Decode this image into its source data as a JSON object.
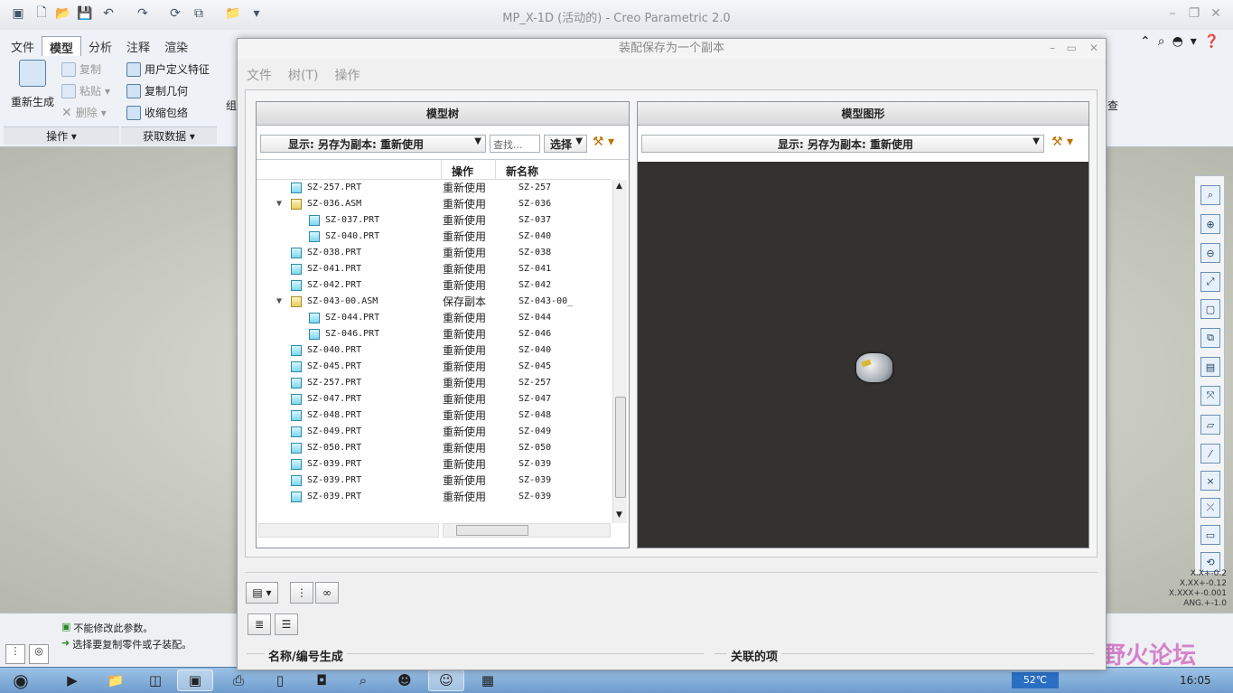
{
  "app": {
    "title": "MP_X-1D (活动的) - Creo Parametric 2.0"
  },
  "ribbon": {
    "tabs": [
      {
        "label": "文件"
      },
      {
        "label": "模型"
      },
      {
        "label": "分析"
      },
      {
        "label": "注释"
      },
      {
        "label": "渲染"
      }
    ],
    "regen_label": "重新生成",
    "copy_label": "复制",
    "paste_label": "粘贴",
    "delete_label": "删除",
    "udf_label": "用户定义特征",
    "copy_geom_label": "复制几何",
    "shrinkwrap_label": "收缩包络",
    "group_ops": "操作 ▾",
    "group_data": "获取数据 ▾",
    "partial1": "组",
    "partial2": "查"
  },
  "status": {
    "msg1": "不能修改此参数。",
    "msg2": "选择要复制零件或子装配。"
  },
  "tolerance": {
    "lines": [
      "X.X+-0.2",
      "X.XX+-0.12",
      "X.XXX+-0.001",
      "ANG.+-1.0"
    ]
  },
  "taskbar": {
    "temp": "52℃",
    "time": "16:05",
    "watermark": "野火论坛"
  },
  "dialog": {
    "title": "装配保存为一个副本",
    "menu": [
      "文件",
      "树(T)",
      "操作"
    ],
    "tree_panel": {
      "title": "模型树",
      "display": "显示: 另存为副本: 重新使用",
      "search": "查找...",
      "select": "选择",
      "col_op": "操作",
      "col_newname": "新名称"
    },
    "graphics_panel": {
      "title": "模型图形",
      "display": "显示: 另存为副本: 重新使用"
    },
    "bottom": {
      "name_gen": "名称/编号生成",
      "related": "关联的项"
    }
  },
  "tree_rows": [
    {
      "name": "SZ-257.PRT",
      "op": "重新使用",
      "new": "SZ-257",
      "type": "prt",
      "level": 0,
      "expand": ""
    },
    {
      "name": "SZ-036.ASM",
      "op": "重新使用",
      "new": "SZ-036",
      "type": "asm",
      "level": 0,
      "expand": "▼"
    },
    {
      "name": "SZ-037.PRT",
      "op": "重新使用",
      "new": "SZ-037",
      "type": "prt",
      "level": 1,
      "expand": ""
    },
    {
      "name": "SZ-040.PRT",
      "op": "重新使用",
      "new": "SZ-040",
      "type": "prt",
      "level": 1,
      "expand": ""
    },
    {
      "name": "SZ-038.PRT",
      "op": "重新使用",
      "new": "SZ-038",
      "type": "prt",
      "level": 0,
      "expand": ""
    },
    {
      "name": "SZ-041.PRT",
      "op": "重新使用",
      "new": "SZ-041",
      "type": "prt",
      "level": 0,
      "expand": ""
    },
    {
      "name": "SZ-042.PRT",
      "op": "重新使用",
      "new": "SZ-042",
      "type": "prt",
      "level": 0,
      "expand": ""
    },
    {
      "name": "SZ-043-00.ASM",
      "op": "保存副本",
      "new": "SZ-043-00_",
      "type": "asm",
      "level": 0,
      "expand": "▼"
    },
    {
      "name": "SZ-044.PRT",
      "op": "重新使用",
      "new": "SZ-044",
      "type": "prt",
      "level": 1,
      "expand": ""
    },
    {
      "name": "SZ-046.PRT",
      "op": "重新使用",
      "new": "SZ-046",
      "type": "prt",
      "level": 1,
      "expand": ""
    },
    {
      "name": "SZ-040.PRT",
      "op": "重新使用",
      "new": "SZ-040",
      "type": "prt",
      "level": 0,
      "expand": ""
    },
    {
      "name": "SZ-045.PRT",
      "op": "重新使用",
      "new": "SZ-045",
      "type": "prt",
      "level": 0,
      "expand": ""
    },
    {
      "name": "SZ-257.PRT",
      "op": "重新使用",
      "new": "SZ-257",
      "type": "prt",
      "level": 0,
      "expand": ""
    },
    {
      "name": "SZ-047.PRT",
      "op": "重新使用",
      "new": "SZ-047",
      "type": "prt",
      "level": 0,
      "expand": ""
    },
    {
      "name": "SZ-048.PRT",
      "op": "重新使用",
      "new": "SZ-048",
      "type": "prt",
      "level": 0,
      "expand": ""
    },
    {
      "name": "SZ-049.PRT",
      "op": "重新使用",
      "new": "SZ-049",
      "type": "prt",
      "level": 0,
      "expand": ""
    },
    {
      "name": "SZ-050.PRT",
      "op": "重新使用",
      "new": "SZ-050",
      "type": "prt",
      "level": 0,
      "expand": ""
    },
    {
      "name": "SZ-039.PRT",
      "op": "重新使用",
      "new": "SZ-039",
      "type": "prt",
      "level": 0,
      "expand": ""
    },
    {
      "name": "SZ-039.PRT",
      "op": "重新使用",
      "new": "SZ-039",
      "type": "prt",
      "level": 0,
      "expand": ""
    },
    {
      "name": "SZ-039.PRT",
      "op": "重新使用",
      "new": "SZ-039",
      "type": "prt",
      "level": 0,
      "expand": ""
    }
  ]
}
